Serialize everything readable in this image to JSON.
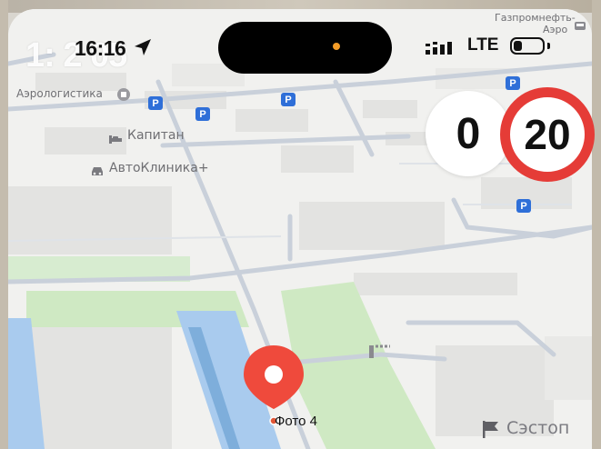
{
  "status_bar": {
    "time": "16:16",
    "watermark_text": "1:    2  05",
    "network": "LTE",
    "battery_level": 0.3
  },
  "map": {
    "labels": {
      "top_right_line1": "Газпромнефть-",
      "top_right_line2": "Аэро",
      "aerologistika": "Аэрологистика",
      "kapitan": "Капитан",
      "avtoklinika": "АвтоКлиника+",
      "sestop": "Сэстоп",
      "photo": "Фото 4"
    },
    "parking_symbol": "P"
  },
  "speed": {
    "current": "0",
    "limit": "20"
  },
  "colors": {
    "accent_red": "#e53c37",
    "parking_blue": "#2f6fd8",
    "water_blue": "#a9cbee",
    "park_green": "#cfe9c3"
  },
  "icons": [
    "location-arrow-icon",
    "signal-icon",
    "battery-icon",
    "hotel-icon",
    "car-icon",
    "store-icon",
    "flag-icon",
    "fuel-icon",
    "railway-icon",
    "pin-icon"
  ]
}
